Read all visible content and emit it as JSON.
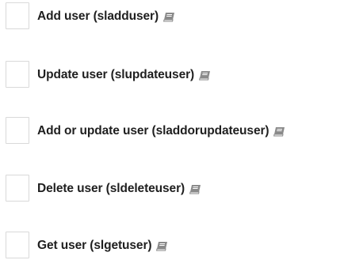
{
  "items": [
    {
      "label": "Add user (sladduser)",
      "checked": false,
      "icon": "book-icon"
    },
    {
      "label": "Update user (slupdateuser)",
      "checked": false,
      "icon": "book-icon"
    },
    {
      "label": "Add or update user (sladdorupdateuser)",
      "checked": false,
      "icon": "book-icon"
    },
    {
      "label": "Delete user (sldeleteuser)",
      "checked": false,
      "icon": "book-icon"
    },
    {
      "label": "Get user (slgetuser)",
      "checked": false,
      "icon": "book-icon"
    }
  ],
  "colors": {
    "text": "#1f1f1f",
    "checkbox_border": "#d9d9d9",
    "icon": "#8a8a8a"
  }
}
